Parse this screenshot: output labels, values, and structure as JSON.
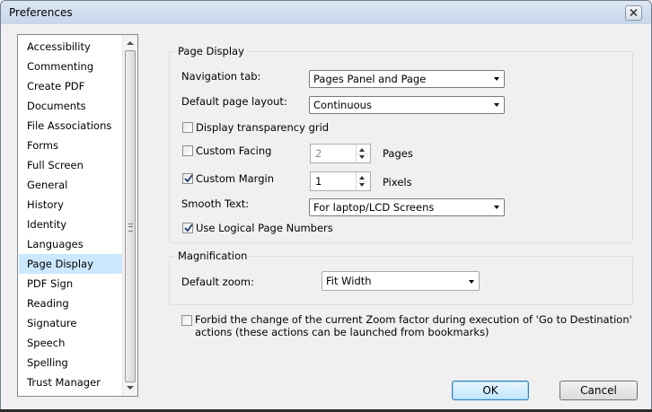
{
  "window": {
    "title": "Preferences"
  },
  "categories": {
    "items": [
      "Accessibility",
      "Commenting",
      "Create PDF",
      "Documents",
      "File Associations",
      "Forms",
      "Full Screen",
      "General",
      "History",
      "Identity",
      "Languages",
      "Page Display",
      "PDF Sign",
      "Reading",
      "Signature",
      "Speech",
      "Spelling",
      "Trust Manager"
    ],
    "selected": "Page Display"
  },
  "page_display": {
    "group_title": "Page Display",
    "navigation_tab": {
      "label": "Navigation tab:",
      "value": "Pages Panel and Page"
    },
    "default_layout": {
      "label": "Default page layout:",
      "value": "Continuous"
    },
    "transparency_grid": {
      "label": "Display transparency grid",
      "checked": false
    },
    "custom_facing": {
      "label": "Custom Facing",
      "checked": false,
      "value": "2",
      "unit": "Pages"
    },
    "custom_margin": {
      "label": "Custom Margin",
      "checked": true,
      "value": "1",
      "unit": "Pixels"
    },
    "smooth_text": {
      "label": "Smooth Text:",
      "value": "For laptop/LCD Screens"
    },
    "logical_page_numbers": {
      "label": "Use Logical Page Numbers",
      "checked": true
    }
  },
  "magnification": {
    "group_title": "Magnification",
    "default_zoom": {
      "label": "Default zoom:",
      "value": "Fit Width"
    }
  },
  "forbid_zoom_change": {
    "checked": false,
    "line1": "Forbid the change of the current Zoom factor during execution of  'Go to Destination'",
    "line2": "actions (these actions can be launched from bookmarks)"
  },
  "buttons": {
    "ok": "OK",
    "cancel": "Cancel"
  },
  "colors": {
    "selection": "#cce8ff",
    "titlebar": "#c7d6ea",
    "window_bg": "#f0f0f0"
  }
}
